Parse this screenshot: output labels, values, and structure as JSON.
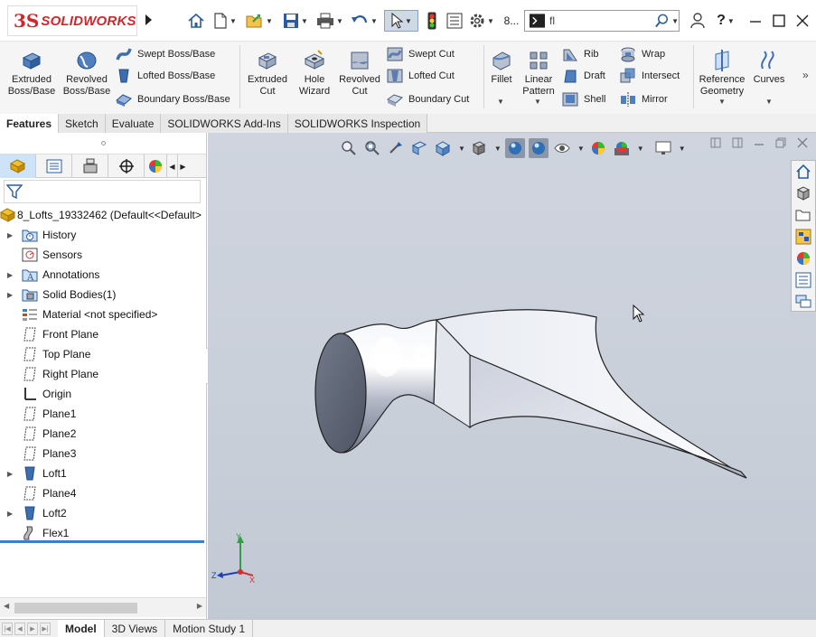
{
  "app": {
    "brand": "SOLIDWORKS",
    "brand_prefix": "3S"
  },
  "quick_access": {
    "filename_short": "8...",
    "search_placeholder": "",
    "search_value": "fl"
  },
  "ribbon": {
    "extruded_boss": "Extruded Boss/Base",
    "revolved_boss": "Revolved Boss/Base",
    "swept_boss": "Swept Boss/Base",
    "lofted_boss": "Lofted Boss/Base",
    "boundary_boss": "Boundary Boss/Base",
    "extruded_cut": "Extruded Cut",
    "hole_wizard": "Hole Wizard",
    "revolved_cut": "Revolved Cut",
    "swept_cut": "Swept Cut",
    "lofted_cut": "Lofted Cut",
    "boundary_cut": "Boundary Cut",
    "fillet": "Fillet",
    "linear_pattern": "Linear Pattern",
    "rib": "Rib",
    "draft": "Draft",
    "shell": "Shell",
    "wrap": "Wrap",
    "intersect": "Intersect",
    "mirror": "Mirror",
    "reference_geometry": "Reference Geometry",
    "curves": "Curves"
  },
  "command_tabs": [
    "Features",
    "Sketch",
    "Evaluate",
    "SOLIDWORKS Add-Ins",
    "SOLIDWORKS Inspection"
  ],
  "tree": {
    "root": "8_Lofts_19332462  (Default<<Default>",
    "items": [
      {
        "label": "History",
        "expandable": true,
        "icon": "history-icon"
      },
      {
        "label": "Sensors",
        "expandable": false,
        "icon": "sensors-icon"
      },
      {
        "label": "Annotations",
        "expandable": true,
        "icon": "annotations-icon"
      },
      {
        "label": "Solid Bodies(1)",
        "expandable": true,
        "icon": "solid-bodies-icon"
      },
      {
        "label": "Material <not specified>",
        "expandable": false,
        "icon": "material-icon"
      },
      {
        "label": "Front Plane",
        "expandable": false,
        "icon": "plane-icon"
      },
      {
        "label": "Top Plane",
        "expandable": false,
        "icon": "plane-icon"
      },
      {
        "label": "Right Plane",
        "expandable": false,
        "icon": "plane-icon"
      },
      {
        "label": "Origin",
        "expandable": false,
        "icon": "origin-icon"
      },
      {
        "label": "Plane1",
        "expandable": false,
        "icon": "plane-icon"
      },
      {
        "label": "Plane2",
        "expandable": false,
        "icon": "plane-icon"
      },
      {
        "label": "Plane3",
        "expandable": false,
        "icon": "plane-icon"
      },
      {
        "label": "Loft1",
        "expandable": true,
        "icon": "loft-icon"
      },
      {
        "label": "Plane4",
        "expandable": false,
        "icon": "plane-icon"
      },
      {
        "label": "Loft2",
        "expandable": true,
        "icon": "loft-icon"
      },
      {
        "label": "Flex1",
        "expandable": false,
        "icon": "flex-icon"
      }
    ]
  },
  "triad": {
    "y": "Y",
    "x": "X",
    "z": "Z"
  },
  "bottom_tabs": [
    "Model",
    "3D Views",
    "Motion Study 1"
  ],
  "colors": {
    "brand_red": "#d0262d",
    "viewport_bg": "#cbd0da",
    "accent_blue": "#3b7fc4"
  }
}
